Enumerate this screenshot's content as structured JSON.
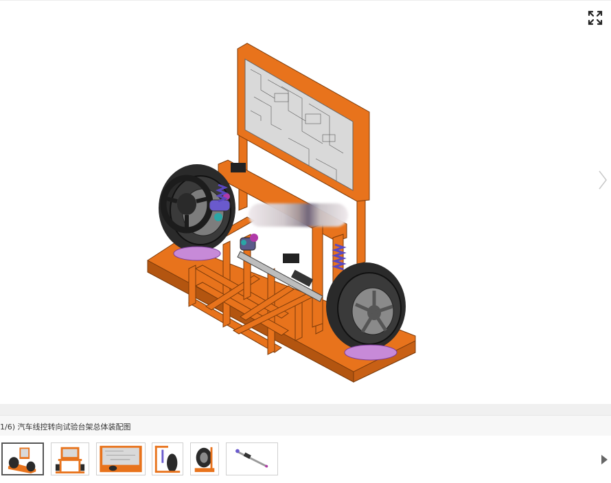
{
  "viewer": {
    "caption": "1/6) 汽车线控转向试验台架总体装配图",
    "current_index": 1,
    "total": 6
  },
  "colors": {
    "frame": "#e8731c",
    "frame_dark": "#b35510",
    "tire": "#2a2a2a",
    "rim": "#8a8a8a",
    "spring": "#6a5acd",
    "magenta": "#b03aa8",
    "board": "#d9d9d9"
  },
  "icons": {
    "fullscreen": "expand-arrows-icon",
    "next": "chevron-right-icon",
    "thumb_next": "triangle-right-icon"
  },
  "thumbnails": [
    {
      "name": "thumb-assembly-iso",
      "active": true
    },
    {
      "name": "thumb-front-view",
      "active": false
    },
    {
      "name": "thumb-board-view",
      "active": false
    },
    {
      "name": "thumb-side-view",
      "active": false
    },
    {
      "name": "thumb-wheel-view",
      "active": false
    },
    {
      "name": "thumb-rack-view",
      "active": false
    }
  ]
}
